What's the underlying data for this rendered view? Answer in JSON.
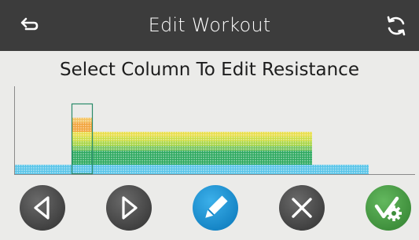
{
  "header": {
    "title": "Edit Workout",
    "back_icon": "back-arrow-icon",
    "sync_icon": "sync-icon",
    "background": "#3c3c3c"
  },
  "instruction": "Select Column To Edit Resistance",
  "workout_chart": {
    "levels": [
      2,
      2,
      2,
      2,
      2,
      2,
      2,
      2,
      12,
      12,
      12,
      9,
      9,
      9,
      9,
      9,
      9,
      9,
      9,
      9,
      9,
      9,
      9,
      9,
      9,
      9,
      9,
      9,
      9,
      9,
      9,
      9,
      9,
      9,
      9,
      9,
      9,
      9,
      9,
      9,
      9,
      9,
      2,
      2,
      2,
      2,
      2,
      2,
      2,
      2
    ],
    "selected_column_range": [
      8,
      10
    ],
    "level_colors": [
      "#58c4e8",
      "#58c4e8",
      "#2ba85e",
      "#2ba85e",
      "#2ba85e",
      "#76c55a",
      "#a9d545",
      "#cddd45",
      "#e8dd4a",
      "#f2a43c",
      "#f2a43c",
      "#f4c25e"
    ],
    "selection_color": "#2a8a6a"
  },
  "buttons": [
    {
      "name": "previous-button",
      "icon": "triangle-left-icon",
      "style": "gray"
    },
    {
      "name": "next-button",
      "icon": "triangle-right-icon",
      "style": "gray"
    },
    {
      "name": "edit-button",
      "icon": "pencil-icon",
      "style": "blue"
    },
    {
      "name": "cancel-button",
      "icon": "close-icon",
      "style": "gray"
    },
    {
      "name": "save-button",
      "icon": "check-gear-icon",
      "style": "green"
    }
  ]
}
